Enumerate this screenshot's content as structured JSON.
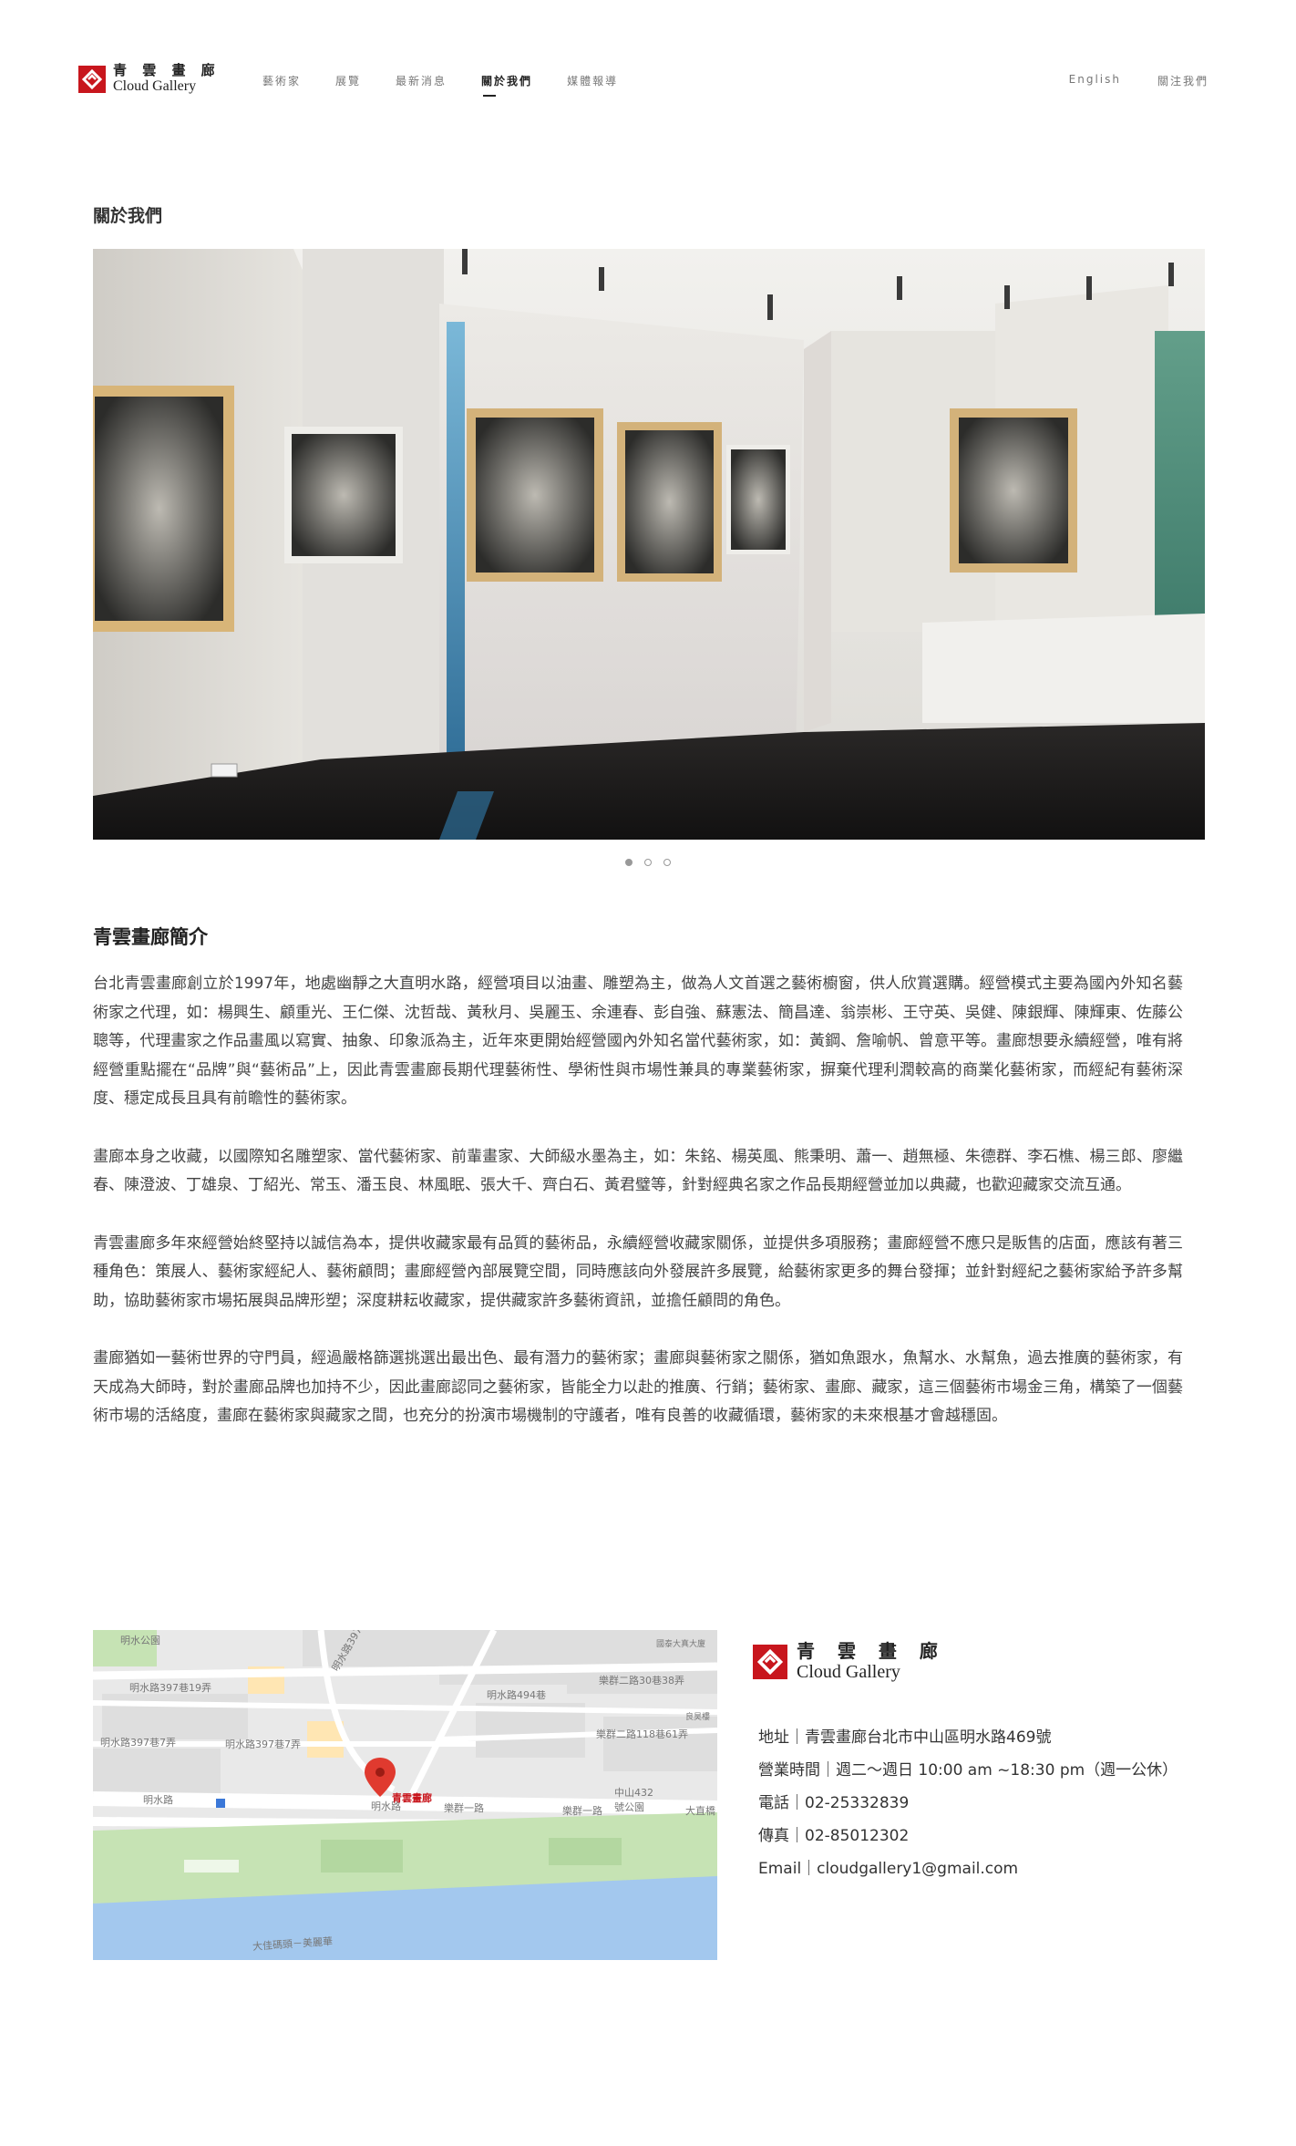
{
  "header": {
    "logo_cn": "青 雲 畫 廊",
    "logo_en": "Cloud Gallery",
    "nav": [
      {
        "label": "藝術家",
        "active": false
      },
      {
        "label": "展覽",
        "active": false
      },
      {
        "label": "最新消息",
        "active": false
      },
      {
        "label": "關於我們",
        "active": true
      },
      {
        "label": "媒體報導",
        "active": false
      }
    ],
    "language_label": "English",
    "follow_label": "關注我們"
  },
  "about": {
    "heading": "關於我們",
    "slides_count": 3,
    "active_slide": 1
  },
  "intro": {
    "title": "青雲畫廊簡介",
    "paragraphs": [
      "台北青雲畫廊創立於1997年，地處幽靜之大直明水路，經營項目以油畫、雕塑為主，做為人文首選之藝術櫥窗，供人欣賞選購。經營模式主要為國內外知名藝術家之代理，如：楊興生、顧重光、王仁傑、沈哲哉、黃秋月、吳麗玉、余連春、彭自強、蘇憲法、簡昌達、翁崇彬、王守英、吳健、陳銀輝、陳輝東、佐藤公聰等，代理畫家之作品畫風以寫實、抽象、印象派為主，近年來更開始經營國內外知名當代藝術家，如：黃鋼、詹喻帆、曾意平等。畫廊想要永續經營，唯有將經營重點擺在“品牌”與“藝術品”上，因此青雲畫廊長期代理藝術性、學術性與市場性兼具的專業藝術家，摒棄代理利潤較高的商業化藝術家，而經紀有藝術深度、穩定成長且具有前瞻性的藝術家。",
      "畫廊本身之收藏，以國際知名雕塑家、當代藝術家、前輩畫家、大師級水墨為主，如：朱銘、楊英風、熊秉明、蕭一、趙無極、朱德群、李石樵、楊三郎、廖繼春、陳澄波、丁雄泉、丁紹光、常玉、潘玉良、林風眠、張大千、齊白石、黃君璧等，針對經典名家之作品長期經營並加以典藏，也歡迎藏家交流互通。",
      "青雲畫廊多年來經營始終堅持以誠信為本，提供收藏家最有品質的藝術品，永續經營收藏家關係，並提供多項服務；畫廊經營不應只是販售的店面，應該有著三種角色：策展人、藝術家經紀人、藝術顧問；畫廊經營內部展覽空間，同時應該向外發展許多展覽，給藝術家更多的舞台發揮；並針對經紀之藝術家給予許多幫助，協助藝術家市場拓展與品牌形塑；深度耕耘收藏家，提供藏家許多藝術資訊，並擔任顧問的角色。",
      "畫廊猶如一藝術世界的守門員，經過嚴格篩選挑選出最出色、最有潛力的藝術家；畫廊與藝術家之關係，猶如魚跟水，魚幫水、水幫魚，過去推廣的藝術家，有天成為大師時，對於畫廊品牌也加持不少，因此畫廊認同之藝術家，皆能全力以赴的推廣、行銷；藝術家、畫廊、藏家，這三個藝術市場金三角，構築了一個藝術市場的活絡度，畫廊在藝術家與藏家之間，也充分的扮演市場機制的守護者，唯有良善的收藏循環，藝術家的未來根基才會越穩固。"
    ]
  },
  "map": {
    "labels": {
      "park": "明水公園",
      "r1": "明水路397巷19弄",
      "r2": "明水路397巷7弄",
      "r3": "明水路397巷7弄",
      "r4": "明水路494巷",
      "r5": "樂群二路30巷38弄",
      "r6": "樂群二路118巷61弄",
      "r7": "明水路",
      "r8": "明水路",
      "r9": "樂群一路",
      "r10": "樂群一路",
      "r11": "中山432號公園",
      "r12": "大直橋",
      "r13": "明水路397巷7弄",
      "pin": "青雲畫廊",
      "river": "大佳碼頭－美麗華",
      "store": "國泰大真大廈",
      "store2": "良昊樓"
    }
  },
  "contact": {
    "logo_cn": "青 雲 畫 廊",
    "logo_en": "Cloud Gallery",
    "lines": [
      "地址｜青雲畫廊台北市中山區明水路469號",
      "營業時間｜週二～週日 10:00 am ~18:30 pm（週一公休）",
      "電話｜02-25332839",
      "傳真｜02-85012302",
      "Email｜cloudgallery1@gmail.com"
    ]
  },
  "colors": {
    "brand_red": "#c8161d",
    "text": "#333333",
    "map_water": "#a3c8ee",
    "map_park": "#c6e3b4",
    "map_pin": "#e03a2f"
  }
}
